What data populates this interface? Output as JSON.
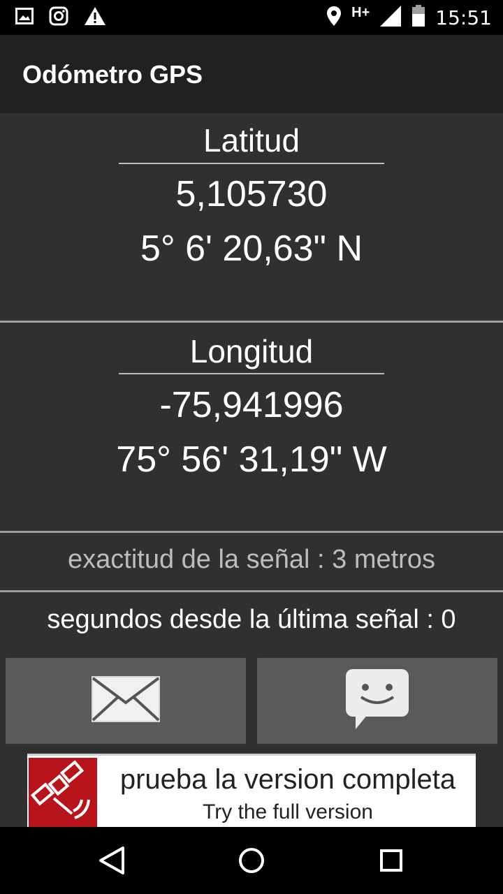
{
  "status_bar": {
    "time": "15:51",
    "network": "H+",
    "left_icons": [
      "image-icon",
      "instagram-icon",
      "warning-icon"
    ],
    "right_icons": [
      "location-pin-icon",
      "signal-icon",
      "battery-icon"
    ]
  },
  "app": {
    "title": "Odómetro GPS"
  },
  "latitude": {
    "label": "Latitud",
    "decimal": "5,105730",
    "dms": "5° 6' 20,63\" N"
  },
  "longitude": {
    "label": "Longitud",
    "decimal": "-75,941996",
    "dms": "75° 56' 31,19\" W"
  },
  "signal": {
    "accuracy_text": "exactitud de la señal : 3 metros",
    "seconds_since_text": "segundos desde la última señal : 0"
  },
  "actions": {
    "email_icon": "envelope-icon",
    "sms_icon": "chat-bubble-icon"
  },
  "banner": {
    "main_text": "prueba la version completa",
    "sub_text": "Try the full version",
    "accent_color": "#b8141c"
  },
  "nav_bar": {
    "icons": [
      "back-icon",
      "home-icon",
      "recents-icon"
    ]
  }
}
